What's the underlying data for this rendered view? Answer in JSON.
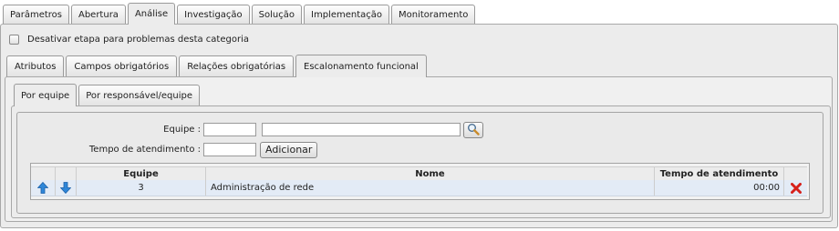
{
  "top_tabs": [
    {
      "label": "Parâmetros",
      "active": false
    },
    {
      "label": "Abertura",
      "active": false
    },
    {
      "label": "Análise",
      "active": true
    },
    {
      "label": "Investigação",
      "active": false
    },
    {
      "label": "Solução",
      "active": false
    },
    {
      "label": "Implementação",
      "active": false
    },
    {
      "label": "Monitoramento",
      "active": false
    }
  ],
  "disable_stage": {
    "label": "Desativar etapa para problemas desta categoria",
    "checked": false
  },
  "sub_tabs": [
    {
      "label": "Atributos",
      "active": false
    },
    {
      "label": "Campos obrigatórios",
      "active": false
    },
    {
      "label": "Relações obrigatórias",
      "active": false
    },
    {
      "label": "Escalonamento funcional",
      "active": true
    }
  ],
  "inner_tabs": [
    {
      "label": "Por equipe",
      "active": true
    },
    {
      "label": "Por responsável/equipe",
      "active": false
    }
  ],
  "form": {
    "team_label": "Equipe :",
    "team_code_value": "",
    "team_name_value": "",
    "time_label": "Tempo de atendimento :",
    "time_value": "",
    "add_button": "Adicionar"
  },
  "grid": {
    "columns": {
      "team": "Equipe",
      "name": "Nome",
      "time": "Tempo de atendimento"
    },
    "rows": [
      {
        "team": "3",
        "name": "Administração de rede",
        "time": "00:00"
      }
    ]
  },
  "icons": {
    "search": "magnifier-icon",
    "move_up": "arrow-up-icon",
    "move_down": "arrow-down-icon",
    "delete": "red-x-icon"
  },
  "colors": {
    "arrow_blue": "#2e86d8",
    "delete_red": "#d6201b",
    "row_selected": "#e3ebf6"
  }
}
